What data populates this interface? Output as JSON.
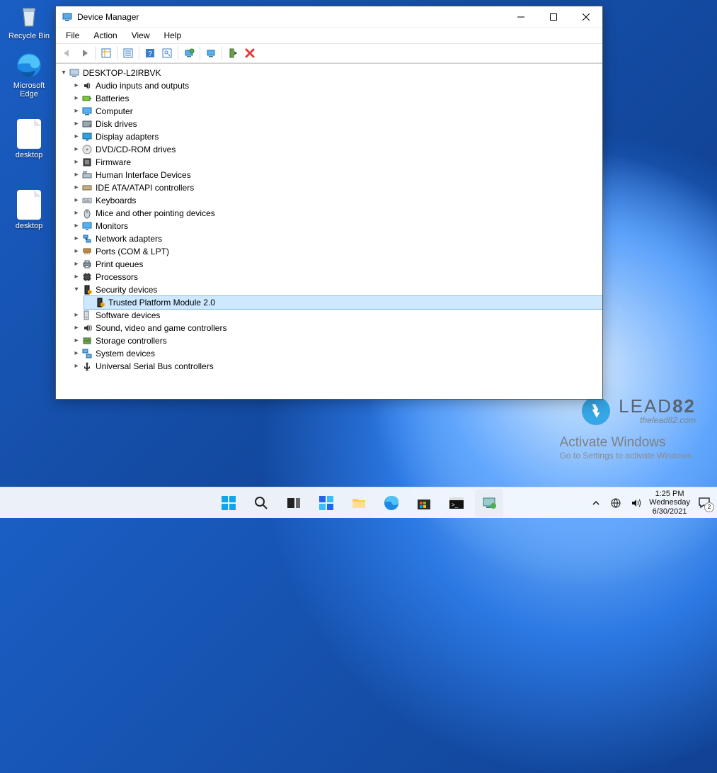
{
  "desktop": {
    "icons": [
      {
        "name": "recycle-bin",
        "label": "Recycle Bin"
      },
      {
        "name": "microsoft-edge",
        "label": "Microsoft Edge"
      },
      {
        "name": "desktop-file-1",
        "label": "desktop"
      },
      {
        "name": "desktop-file-2",
        "label": "desktop"
      }
    ]
  },
  "window": {
    "title": "Device Manager",
    "menubar": [
      "File",
      "Action",
      "View",
      "Help"
    ],
    "toolbar": [
      {
        "name": "back"
      },
      {
        "name": "forward"
      },
      {
        "sep": true
      },
      {
        "name": "show-hidden"
      },
      {
        "sep": true
      },
      {
        "name": "print"
      },
      {
        "sep": true
      },
      {
        "name": "help"
      },
      {
        "name": "find"
      },
      {
        "sep": true
      },
      {
        "name": "update-driver"
      },
      {
        "sep": true
      },
      {
        "name": "computer-mgmt"
      },
      {
        "sep": true
      },
      {
        "name": "enable"
      },
      {
        "name": "uninstall-x"
      }
    ],
    "root": "DESKTOP-L2IRBVK",
    "categories": [
      {
        "label": "Audio inputs and outputs",
        "icon": "audio-icon"
      },
      {
        "label": "Batteries",
        "icon": "battery-icon"
      },
      {
        "label": "Computer",
        "icon": "computer-icon"
      },
      {
        "label": "Disk drives",
        "icon": "disk-icon"
      },
      {
        "label": "Display adapters",
        "icon": "display-icon"
      },
      {
        "label": "DVD/CD-ROM drives",
        "icon": "dvd-icon"
      },
      {
        "label": "Firmware",
        "icon": "firmware-icon"
      },
      {
        "label": "Human Interface Devices",
        "icon": "hid-icon"
      },
      {
        "label": "IDE ATA/ATAPI controllers",
        "icon": "ide-icon"
      },
      {
        "label": "Keyboards",
        "icon": "keyboard-icon"
      },
      {
        "label": "Mice and other pointing devices",
        "icon": "mouse-icon"
      },
      {
        "label": "Monitors",
        "icon": "monitor-icon"
      },
      {
        "label": "Network adapters",
        "icon": "network-icon"
      },
      {
        "label": "Ports (COM & LPT)",
        "icon": "ports-icon"
      },
      {
        "label": "Print queues",
        "icon": "printer-icon"
      },
      {
        "label": "Processors",
        "icon": "cpu-icon"
      },
      {
        "label": "Security devices",
        "icon": "security-icon",
        "expanded": true,
        "children": [
          {
            "label": "Trusted Platform Module 2.0",
            "icon": "tpm-icon",
            "selected": true
          }
        ]
      },
      {
        "label": "Software devices",
        "icon": "software-icon"
      },
      {
        "label": "Sound, video and game controllers",
        "icon": "sound-icon"
      },
      {
        "label": "Storage controllers",
        "icon": "storage-icon"
      },
      {
        "label": "System devices",
        "icon": "system-icon"
      },
      {
        "label": "Universal Serial Bus controllers",
        "icon": "usb-icon"
      }
    ]
  },
  "watermark": {
    "brand_prefix": "LEAD",
    "brand_bold": "82",
    "site": "thelead82.com"
  },
  "activate": {
    "heading": "Activate Windows",
    "sub": "Go to Settings to activate Windows."
  },
  "taskbar": {
    "apps": [
      {
        "name": "start"
      },
      {
        "name": "search"
      },
      {
        "name": "task-view"
      },
      {
        "name": "widgets"
      },
      {
        "name": "file-explorer"
      },
      {
        "name": "edge"
      },
      {
        "name": "microsoft-store"
      },
      {
        "name": "cmd"
      },
      {
        "name": "device-manager",
        "active": true
      }
    ],
    "tray": {
      "time": "1:25 PM",
      "day": "Wednesday",
      "date": "6/30/2021"
    }
  }
}
